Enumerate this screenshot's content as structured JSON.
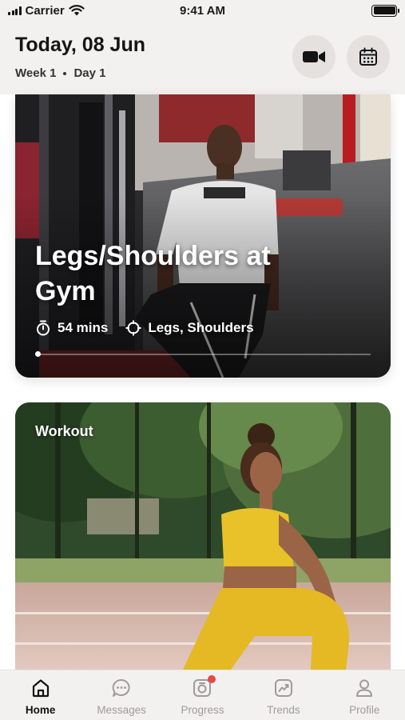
{
  "status_bar": {
    "carrier": "Carrier",
    "time": "9:41 AM",
    "icons": [
      "signal-icon",
      "wifi-icon",
      "battery-icon"
    ]
  },
  "header": {
    "title": "Today, 08 Jun",
    "week": "Week 1",
    "day": "Day 1",
    "buttons": [
      "video-camera-icon",
      "calendar-icon"
    ]
  },
  "cards": {
    "gym": {
      "title": "Legs/Shoulders at Gym",
      "duration": "54 mins",
      "targets": "Legs, Shoulders",
      "slide_index": 1
    },
    "workout": {
      "label": "Workout"
    }
  },
  "tab_bar": {
    "tabs": [
      {
        "label": "Home",
        "icon": "home-icon",
        "active": true
      },
      {
        "label": "Messages",
        "icon": "chat-icon",
        "active": false
      },
      {
        "label": "Progress",
        "icon": "camera-icon",
        "active": false,
        "badge": true
      },
      {
        "label": "Trends",
        "icon": "trend-chart-icon",
        "active": false
      },
      {
        "label": "Profile",
        "icon": "user-icon",
        "active": false
      }
    ]
  },
  "colors": {
    "header_bg": "#f3f1f0",
    "badge": "#e84848",
    "active_tab": "#111111",
    "inactive_tab": "#9e9b99",
    "outfit_yellow": "#e9c128"
  }
}
